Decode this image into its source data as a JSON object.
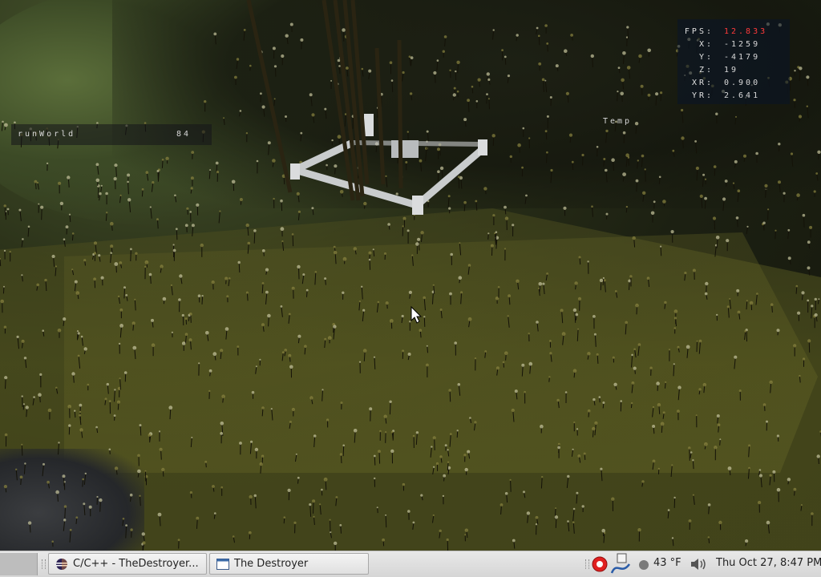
{
  "hud": {
    "stats": [
      {
        "label": "FPS:",
        "value": "12.833",
        "alert": true
      },
      {
        "label": "X:",
        "value": "-1259"
      },
      {
        "label": "Y:",
        "value": "-4179"
      },
      {
        "label": "Z:",
        "value": "19"
      },
      {
        "label": "XR:",
        "value": "0.900"
      },
      {
        "label": "YR:",
        "value": "2.641"
      }
    ],
    "run_world_label": "runWorld",
    "run_world_value": "84",
    "temp_label": "Temp"
  },
  "taskbar": {
    "tasks": [
      {
        "label": "C/C++ - TheDestroyer...",
        "icon": "eclipse-icon"
      },
      {
        "label": "The Destroyer",
        "icon": "window-icon"
      }
    ],
    "tray": {
      "temperature": "43 °F",
      "datetime": "Thu Oct 27,  8:47 PM",
      "icons": [
        "record-icon",
        "network-icon",
        "weather-dot-icon",
        "volume-icon"
      ]
    }
  },
  "colors": {
    "fps_alert": "#ff3a3a",
    "taskbar_bg": "#e0e0e0"
  }
}
